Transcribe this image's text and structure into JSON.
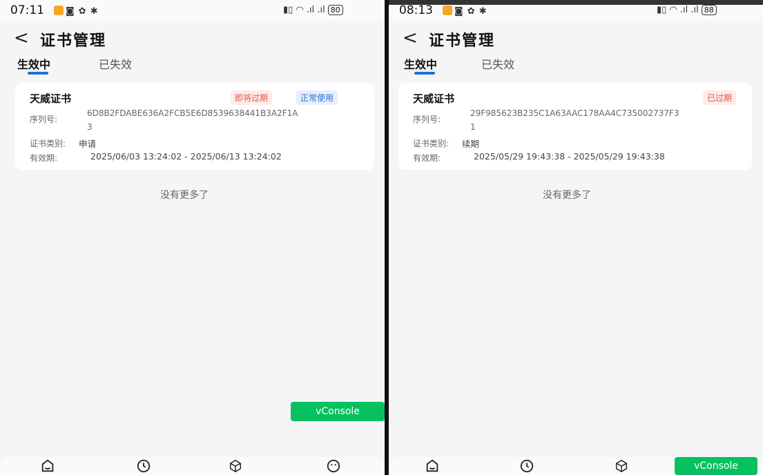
{
  "left": {
    "status": {
      "time": "07:11",
      "battery": "80"
    },
    "header": {
      "back": "<",
      "title": "证书管理"
    },
    "tabs": [
      "生效中",
      "已失效"
    ],
    "card": {
      "name": "天威证书",
      "badges": [
        "即将过期",
        "正常使用"
      ],
      "serial_label": "序列号:",
      "serial": "6D8B2FDABE636A2FCB5E6D8539638441B3A2F1A3",
      "type_label": "证书类别:",
      "type": "申请",
      "validity_label": "有效期:",
      "validity": "2025/06/03 13:24:02 - 2025/06/13 13:24:02"
    },
    "no_more": "没有更多了",
    "vconsole": "vConsole"
  },
  "right": {
    "status": {
      "time": "08:13",
      "battery": "88"
    },
    "header": {
      "back": "<",
      "title": "证书管理"
    },
    "tabs": [
      "生效中",
      "已失效"
    ],
    "card": {
      "name": "天威证书",
      "badges": [
        "已过期"
      ],
      "serial_label": "序列号:",
      "serial": "29F985623B235C1A63AAC178AA4C735002737F31",
      "type_label": "证书类别:",
      "type": "续期",
      "validity_label": "有效期:",
      "validity": "2025/05/29 19:43:38 - 2025/05/29 19:43:38"
    },
    "no_more": "没有更多了",
    "vconsole": "vConsole"
  },
  "nav_icons": [
    "home-icon",
    "clock-icon",
    "cube-icon",
    "face-icon"
  ],
  "colors": {
    "accent": "#1f6fd6",
    "vconsole": "#07c160",
    "badge_red": "#e8524a",
    "badge_blue": "#2a6fd6"
  }
}
